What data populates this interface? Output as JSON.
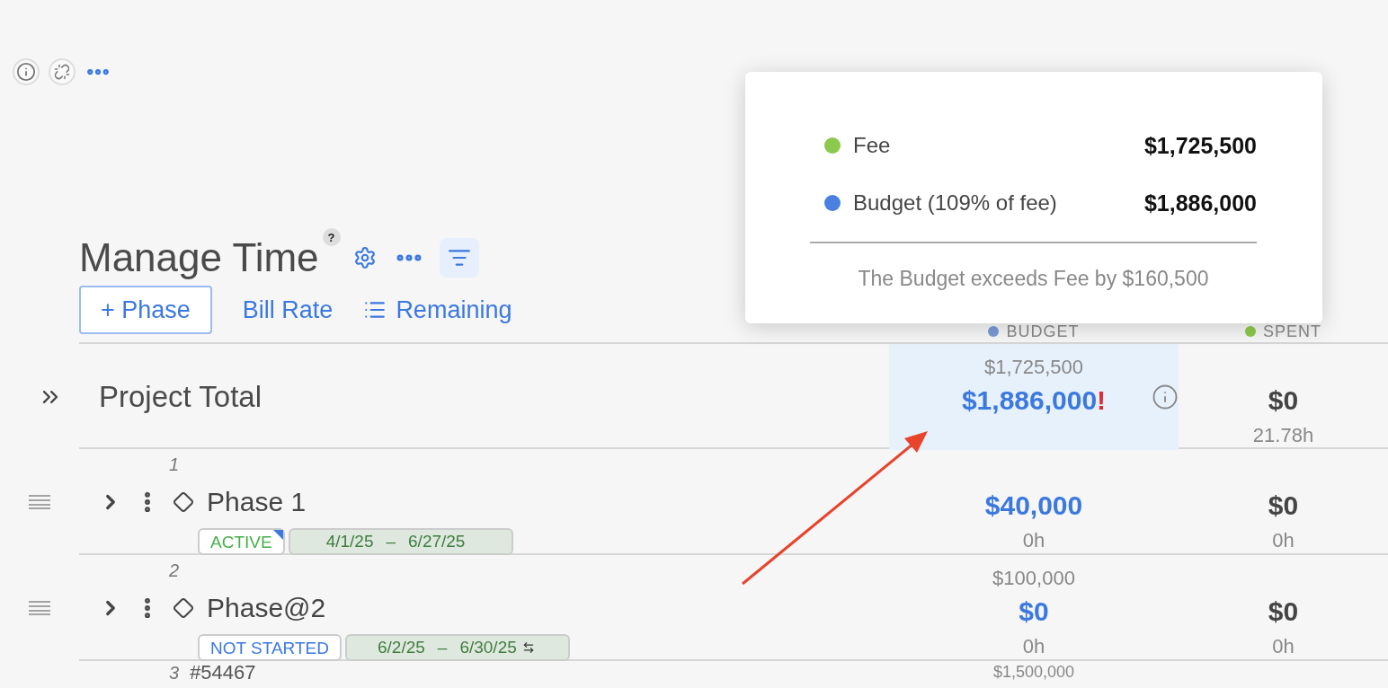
{
  "header": {
    "title": "Manage Time",
    "help": "?"
  },
  "actions": [
    {
      "label": "+ Phase",
      "kind": "outlined"
    },
    {
      "label": "Bill Rate",
      "kind": "link"
    },
    {
      "label": "Remaining",
      "kind": "list"
    }
  ],
  "columns": [
    {
      "label": "BUDGET",
      "color": "#7b9bd6"
    },
    {
      "label": "SPENT",
      "color": "#8cc84b"
    }
  ],
  "total": {
    "label": "Project Total",
    "budget_fee": "$1,725,500",
    "budget": "$1,886,000",
    "warning": "!",
    "spent": "$0",
    "spent_hours": "21.78h",
    "highlighted": true
  },
  "phases": [
    {
      "number": "1",
      "name": "Phase 1",
      "status": "ACTIVE",
      "color": "#45b049",
      "flagged": true,
      "start": "4/1/25",
      "separator": "–",
      "end": "6/27/25",
      "linked": false,
      "budget": "$40,000",
      "budget_hours": "0h",
      "spent": "$0",
      "spent_hours": "0h"
    },
    {
      "number": "2",
      "name": "Phase@2",
      "status": "NOT STARTED",
      "color": "#3b78e0",
      "flagged": false,
      "start": "6/2/25",
      "separator": "–",
      "end": "6/30/25",
      "linked": true,
      "budget_fee": "$100,000",
      "budget": "$0",
      "budget_hours": "0h",
      "spent": "$0",
      "spent_hours": "0h"
    }
  ],
  "partial_row": {
    "number": "3",
    "label": "#54467",
    "budget_fee": "$1,500,000"
  },
  "popover": {
    "items": [
      {
        "label": "Fee",
        "value": "$1,725,500",
        "color": "#8cc84b"
      },
      {
        "label": "Budget",
        "note": "(109% of fee)",
        "value": "$1,886,000",
        "color": "#4a80e0"
      }
    ],
    "message": "The Budget exceeds Fee by $160,500"
  }
}
